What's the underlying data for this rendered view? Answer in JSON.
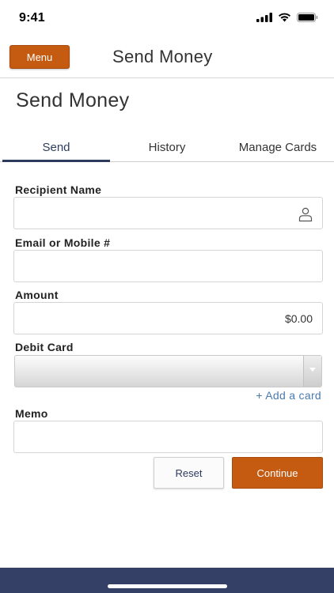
{
  "status_bar": {
    "time": "9:41"
  },
  "header": {
    "menu_label": "Menu",
    "title": "Send Money"
  },
  "page": {
    "title": "Send Money"
  },
  "tabs": [
    {
      "label": "Send",
      "active": true
    },
    {
      "label": "History",
      "active": false
    },
    {
      "label": "Manage Cards",
      "active": false
    }
  ],
  "form": {
    "recipient": {
      "label": "Recipient Name",
      "value": ""
    },
    "contact": {
      "label": "Email or Mobile #",
      "value": ""
    },
    "amount": {
      "label": "Amount",
      "value": "$0.00"
    },
    "debit_card": {
      "label": "Debit Card",
      "selected": ""
    },
    "add_card_link": "+ Add a card",
    "memo": {
      "label": "Memo",
      "value": ""
    }
  },
  "actions": {
    "reset_label": "Reset",
    "continue_label": "Continue"
  },
  "colors": {
    "accent": "#c55a11",
    "navy": "#344066",
    "link": "#4a7ab0"
  }
}
